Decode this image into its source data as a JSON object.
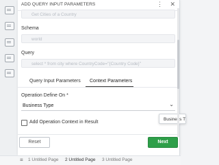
{
  "dialog": {
    "title": "ADD QUERY INPUT PARAMETERS",
    "icons": [
      "ellipsis-vertical-icon",
      "close-icon"
    ]
  },
  "fields": {
    "top_placeholder": "Get Cities of a Country",
    "schema_label": "Schema",
    "schema_value": "world",
    "query_label": "Query",
    "query_value": "select * from city where CountryCode=\"{Country Code}\""
  },
  "tabs": [
    {
      "label": "Query Input Parameters"
    },
    {
      "label": "Context Parameters"
    }
  ],
  "context": {
    "operation_label": "Operation Define On *",
    "operation_value": "Business Type",
    "checkbox_label": "Add Operation Context in Result",
    "dropdown_preview": "Business Type"
  },
  "buttons": {
    "reset": "Reset",
    "next": "Next"
  },
  "page_tabs": [
    {
      "label": "1 Untitled Page"
    },
    {
      "label": "2 Untitled Page"
    },
    {
      "label": "3 Untitled Page"
    }
  ],
  "colors": {
    "accent_green": "#2e9f49",
    "background": "#f3f4f6"
  }
}
